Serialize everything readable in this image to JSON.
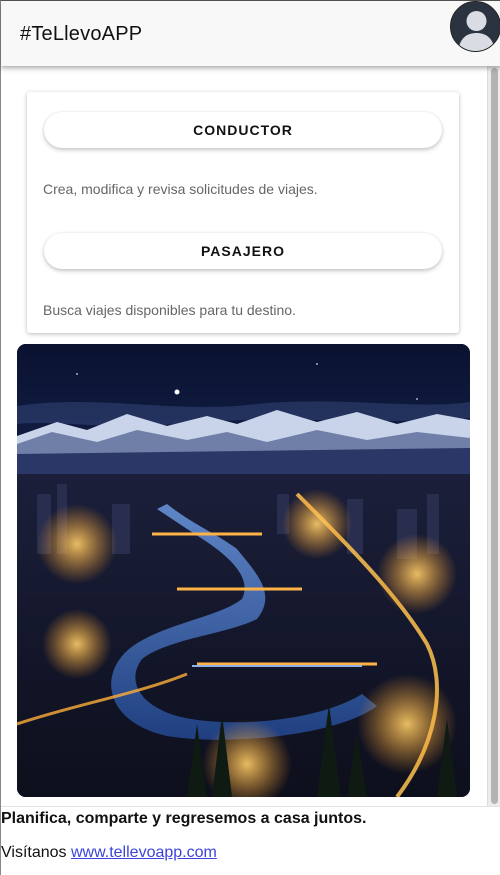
{
  "header": {
    "title": "#TeLlevoAPP",
    "avatar_icon": "user-avatar-icon"
  },
  "roles": {
    "conductor": {
      "label": "CONDUCTOR",
      "description": "Crea, modifica y revisa solicitudes de viajes."
    },
    "pasajero": {
      "label": "PASAJERO",
      "description": "Busca viajes disponibles para tu destino."
    }
  },
  "hero": {
    "subject": "night-city-river-mountains"
  },
  "footer": {
    "tagline": "Planifica, comparte y regresemos a casa juntos.",
    "visit_prefix": "Visítanos",
    "link_text": "www.tellevoapp.com"
  },
  "colors": {
    "link": "#3b44d9",
    "description_text": "#666666",
    "header_bg": "#f8f8f8"
  }
}
